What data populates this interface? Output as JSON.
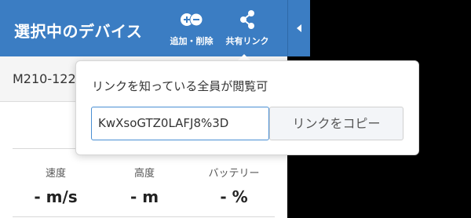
{
  "header": {
    "title": "選択中のデバイス",
    "add_remove_label": "追加・削除",
    "share_label": "共有リンク"
  },
  "device": {
    "name": "M210-122"
  },
  "stats": {
    "speed": {
      "label": "速度",
      "value": "- m/s"
    },
    "altitude": {
      "label": "高度",
      "value": "- m"
    },
    "battery": {
      "label": "バッテリー",
      "value": "- %"
    }
  },
  "share_popover": {
    "title": "リンクを知っている全員が閲覧可",
    "link_value": "KwXsoGTZ0LAFJ8%3D",
    "copy_button_label": "リンクをコピー"
  },
  "colors": {
    "header_bg": "#3b7dc3",
    "input_border": "#4a8fd3"
  },
  "icons": {
    "add_remove": "add-remove-icon",
    "share": "share-icon",
    "collapse": "chevron-left-icon"
  }
}
